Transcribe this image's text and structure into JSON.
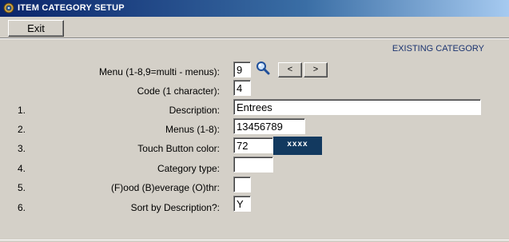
{
  "window": {
    "title": "ITEM CATEGORY SETUP"
  },
  "toolbar": {
    "exit_label": "Exit"
  },
  "status": {
    "text": "EXISTING CATEGORY"
  },
  "header_fields": {
    "menu": {
      "label": "Menu (1-8,9=multi - menus):",
      "value": "9"
    },
    "code": {
      "label": "Code (1 character):",
      "value": "4"
    },
    "prev_label": "<",
    "next_label": ">"
  },
  "rows": [
    {
      "num": "1.",
      "label": "Description:",
      "value": "Entrees"
    },
    {
      "num": "2.",
      "label": "Menus (1-8):",
      "value": "13456789"
    },
    {
      "num": "3.",
      "label": "Touch Button color:",
      "value": "72",
      "swatch_text": "xxxx",
      "swatch_color": "#12395f"
    },
    {
      "num": "4.",
      "label": "Category type:",
      "value": ""
    },
    {
      "num": "5.",
      "label": "(F)ood (B)everage (O)thr:",
      "value": ""
    },
    {
      "num": "6.",
      "label": "Sort by Description?:",
      "value": "Y"
    }
  ],
  "icons": {
    "app": "app-gear-icon",
    "lookup": "magnifier-icon"
  }
}
